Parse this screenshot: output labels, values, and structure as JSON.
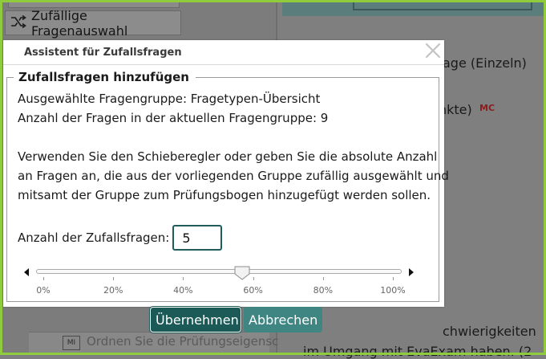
{
  "background": {
    "random_button_label": "Zufällige Fragenauswahl",
    "right_text_1": "age (Einzeln)",
    "right_text_2": "nkte)",
    "mc_badge": "MC",
    "right_bottom_1": "chwierigkeiten",
    "right_bottom_2": "im Umgang mit EvaExam haben. (2",
    "left_bottom": "Ordnen Sie die Prüfungseigensc"
  },
  "dialog": {
    "title": "Assistent für Zufallsfragen",
    "section_legend": "Zufallsfragen hinzufügen",
    "selected_group": "Ausgewählte Fragengruppe: Fragetypen-Übersicht",
    "question_count": "Anzahl der Fragen in der aktuellen Fragengruppe: 9",
    "instruction_lines": [
      "Verwenden Sie den Schieberegler oder geben Sie die absolute Anzahl",
      "an Fragen an, die aus der vorliegenden Gruppe zufällig ausgewählt und",
      "mitsamt der Gruppe zum Prüfungsbogen hinzugefügt werden sollen."
    ],
    "count_label": "Anzahl der Zufallsfragen:",
    "count_value": "5",
    "slider": {
      "value_percent": 50,
      "tick_labels": [
        "0%",
        "20%",
        "40%",
        "60%",
        "80%",
        "100%"
      ]
    },
    "ok_label": "Übernehmen",
    "cancel_label": "Abbrechen"
  },
  "colors": {
    "accent": "#1c5a58",
    "secondary_button": "#3f8582",
    "frame": "#8fcb3c",
    "mc_badge": "#8a1d1d"
  }
}
